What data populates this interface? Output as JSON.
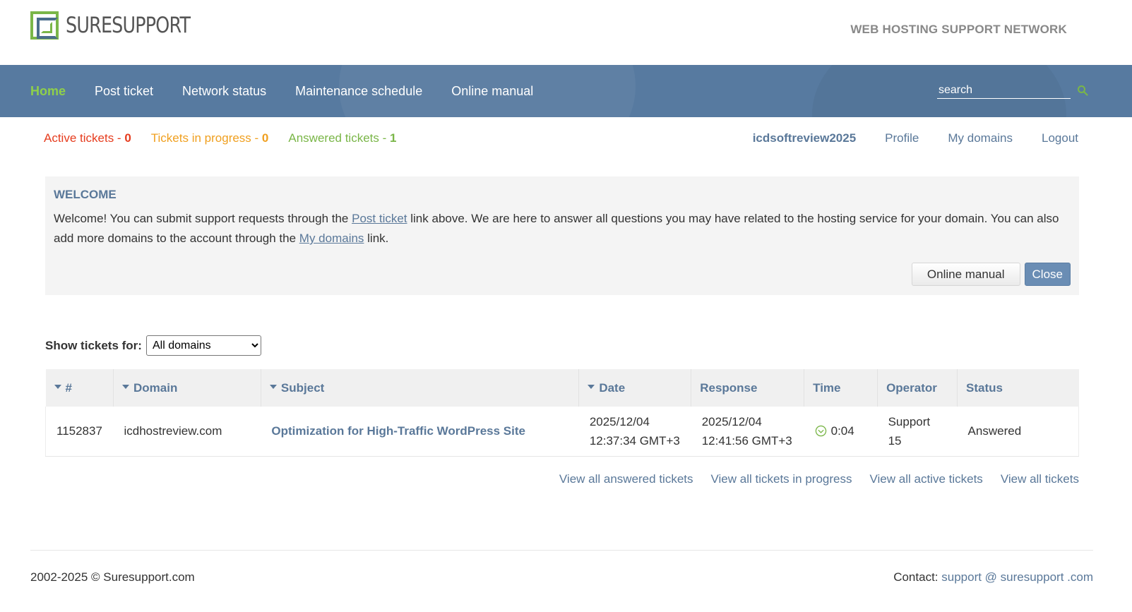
{
  "header": {
    "logo_text": "SURESUPPORT",
    "tagline": "WEB HOSTING SUPPORT NETWORK"
  },
  "nav": {
    "items": [
      {
        "label": "Home",
        "active": true
      },
      {
        "label": "Post ticket"
      },
      {
        "label": "Network status"
      },
      {
        "label": "Maintenance schedule"
      },
      {
        "label": "Online manual"
      }
    ],
    "search_placeholder": "search"
  },
  "status": {
    "active_label": "Active tickets - ",
    "active_count": "0",
    "progress_label": "Tickets in progress - ",
    "progress_count": "0",
    "answered_label": "Answered tickets - ",
    "answered_count": "1"
  },
  "user": {
    "username": "icdsoftreview2025",
    "links": [
      "Profile",
      "My domains",
      "Logout"
    ]
  },
  "welcome": {
    "title": "WELCOME",
    "text_1": "Welcome! You can submit support requests through the ",
    "link_1": "Post ticket",
    "text_2": " link above. We are here to answer all questions you may have related to the hosting service for your domain. You can also add more domains to the account through the ",
    "link_2": "My domains",
    "text_3": " link.",
    "manual_button": "Online manual",
    "close_button": "Close"
  },
  "filter": {
    "label": "Show tickets for:",
    "selected": "All domains"
  },
  "table": {
    "headers": [
      "#",
      "Domain",
      "Subject",
      "Date",
      "Response",
      "Time",
      "Operator",
      "Status"
    ],
    "rows": [
      {
        "id": "1152837",
        "domain": "icdhostreview.com",
        "subject": "Optimization for High-Traffic WordPress Site",
        "date_1": "2025/12/04",
        "date_2": "12:37:34 GMT+3",
        "response_1": "2025/12/04",
        "response_2": "12:41:56 GMT+3",
        "time": "0:04",
        "operator": "Support 15",
        "status": "Answered"
      }
    ]
  },
  "view_links": [
    "View all answered tickets",
    "View all tickets in progress",
    "View all active tickets",
    "View all tickets"
  ],
  "footer": {
    "copyright": "2002-2025 © Suresupport.com",
    "contact_label": "Contact: ",
    "contact_email": "support @ suresupport .com"
  },
  "colors": {
    "nav_bg": "#577aa0",
    "brand_green": "#7ab648",
    "link_blue": "#5a7899",
    "active_red": "#e63c1e",
    "progress_orange": "#f0a020"
  }
}
